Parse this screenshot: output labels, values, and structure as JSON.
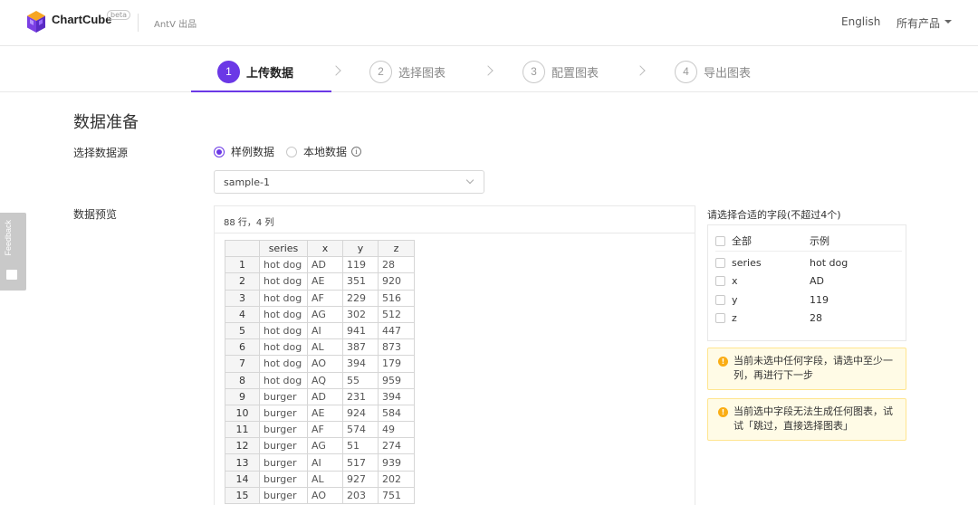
{
  "header": {
    "brand": "ChartCube",
    "badge": "beta",
    "vendor": "AntV 出品",
    "language": "English",
    "products": "所有产品",
    "logo_icon": "cube-logo-icon"
  },
  "steps": [
    {
      "number": "1",
      "label": "上传数据",
      "active": true
    },
    {
      "number": "2",
      "label": "选择图表",
      "active": false
    },
    {
      "number": "3",
      "label": "配置图表",
      "active": false
    },
    {
      "number": "4",
      "label": "导出图表",
      "active": false
    }
  ],
  "page": {
    "title": "数据准备",
    "source_label": "选择数据源",
    "source_options": [
      {
        "label": "样例数据",
        "checked": true
      },
      {
        "label": "本地数据",
        "checked": false
      }
    ],
    "info_icon_text": "i",
    "sample_select": "sample-1",
    "preview_label": "数据预览",
    "preview_meta": "88 行，4 列"
  },
  "table": {
    "headers": [
      "",
      "series",
      "x",
      "y",
      "z"
    ],
    "rows": [
      [
        "1",
        "hot dog",
        "AD",
        "119",
        "28"
      ],
      [
        "2",
        "hot dog",
        "AE",
        "351",
        "920"
      ],
      [
        "3",
        "hot dog",
        "AF",
        "229",
        "516"
      ],
      [
        "4",
        "hot dog",
        "AG",
        "302",
        "512"
      ],
      [
        "5",
        "hot dog",
        "AI",
        "941",
        "447"
      ],
      [
        "6",
        "hot dog",
        "AL",
        "387",
        "873"
      ],
      [
        "7",
        "hot dog",
        "AO",
        "394",
        "179"
      ],
      [
        "8",
        "hot dog",
        "AQ",
        "55",
        "959"
      ],
      [
        "9",
        "burger",
        "AD",
        "231",
        "394"
      ],
      [
        "10",
        "burger",
        "AE",
        "924",
        "584"
      ],
      [
        "11",
        "burger",
        "AF",
        "574",
        "49"
      ],
      [
        "12",
        "burger",
        "AG",
        "51",
        "274"
      ],
      [
        "13",
        "burger",
        "AI",
        "517",
        "939"
      ],
      [
        "14",
        "burger",
        "AL",
        "927",
        "202"
      ],
      [
        "15",
        "burger",
        "AO",
        "203",
        "751"
      ]
    ]
  },
  "fields": {
    "title": "请选择合适的字段(不超过4个)",
    "header_all": "全部",
    "header_example": "示例",
    "items": [
      {
        "name": "series",
        "example": "hot dog"
      },
      {
        "name": "x",
        "example": "AD"
      },
      {
        "name": "y",
        "example": "119"
      },
      {
        "name": "z",
        "example": "28"
      }
    ]
  },
  "alerts": [
    {
      "icon": "warning-icon",
      "text": "当前未选中任何字段，请选中至少一列，再进行下一步"
    },
    {
      "icon": "warning-icon",
      "text": "当前选中字段无法生成任何图表，试试「跳过，直接选择图表」"
    }
  ],
  "feedback": {
    "label": "Feedback",
    "icon": "chat-icon"
  },
  "colors": {
    "accent": "#6b38e6",
    "warning": "#faad14",
    "alert_bg": "#fffbe6"
  }
}
